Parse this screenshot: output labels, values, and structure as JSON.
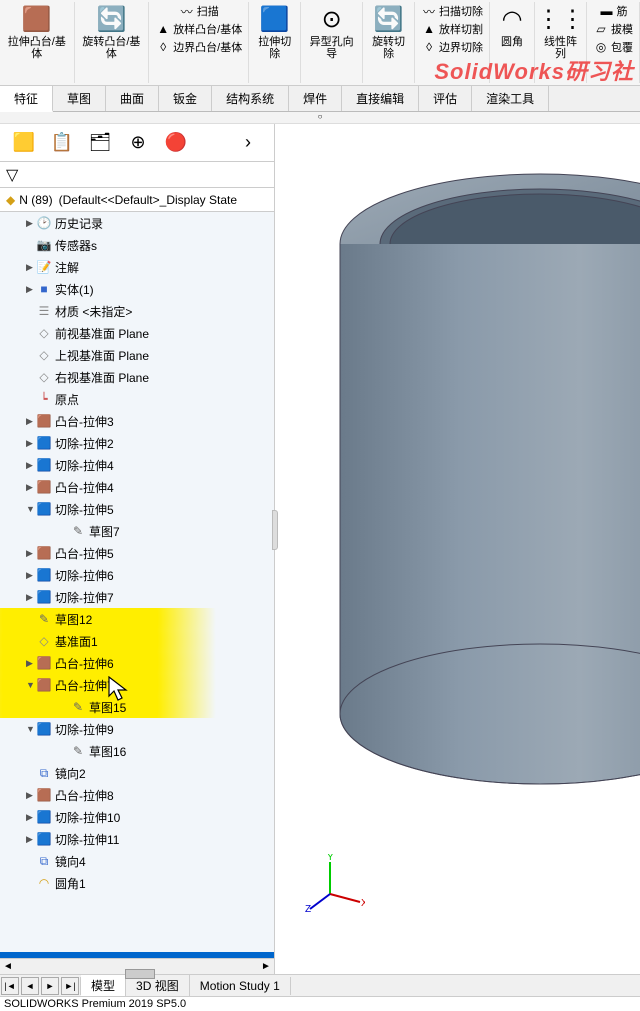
{
  "ribbon": {
    "extrudeBoss": "拉伸凸台/基体",
    "revolveBoss": "旋转凸台/基体",
    "sweep": "扫描",
    "loft": "放样凸台/基体",
    "boundary": "边界凸台/基体",
    "extrudeCut": "拉伸切除",
    "holeWizard": "异型孔向导",
    "revolveCut": "旋转切除",
    "sweptCut": "扫描切除",
    "loftCut": "放样切割",
    "boundaryCut": "边界切除",
    "fillet": "圆角",
    "linearPattern": "线性阵列",
    "rib": "筋",
    "draft": "拔模",
    "wrap": "包覆"
  },
  "tabs": {
    "feature": "特征",
    "sketch": "草图",
    "surface": "曲面",
    "sheetmetal": "钣金",
    "structure": "结构系统",
    "weldment": "焊件",
    "directEdit": "直接编辑",
    "evaluate": "评估",
    "renderTools": "渲染工具"
  },
  "header": {
    "partName": "N (89)",
    "config": "(Default<<Default>_Display State"
  },
  "tree": [
    {
      "label": "历史记录",
      "icon": "history",
      "exp": "▶",
      "indent": 1
    },
    {
      "label": "传感器s",
      "icon": "sensor",
      "exp": "",
      "indent": 1
    },
    {
      "label": "注解",
      "icon": "annotation",
      "exp": "▶",
      "indent": 1
    },
    {
      "label": "实体(1)",
      "icon": "solid",
      "exp": "▶",
      "indent": 1
    },
    {
      "label": "材质 <未指定>",
      "icon": "material",
      "exp": "",
      "indent": 1
    },
    {
      "label": "前视基准面 Plane",
      "icon": "plane",
      "exp": "",
      "indent": 1
    },
    {
      "label": "上视基准面 Plane",
      "icon": "plane",
      "exp": "",
      "indent": 1
    },
    {
      "label": "右视基准面 Plane",
      "icon": "plane",
      "exp": "",
      "indent": 1
    },
    {
      "label": "原点",
      "icon": "origin",
      "exp": "",
      "indent": 1
    },
    {
      "label": "凸台-拉伸3",
      "icon": "extrude",
      "exp": "▶",
      "indent": 1
    },
    {
      "label": "切除-拉伸2",
      "icon": "cut",
      "exp": "▶",
      "indent": 1
    },
    {
      "label": "切除-拉伸4",
      "icon": "cut",
      "exp": "▶",
      "indent": 1
    },
    {
      "label": "凸台-拉伸4",
      "icon": "extrude",
      "exp": "▶",
      "indent": 1
    },
    {
      "label": "切除-拉伸5",
      "icon": "cut",
      "exp": "▼",
      "indent": 1
    },
    {
      "label": "草图7",
      "icon": "sketch",
      "exp": "",
      "indent": 3
    },
    {
      "label": "凸台-拉伸5",
      "icon": "extrude",
      "exp": "▶",
      "indent": 1
    },
    {
      "label": "切除-拉伸6",
      "icon": "cut",
      "exp": "▶",
      "indent": 1
    },
    {
      "label": "切除-拉伸7",
      "icon": "cut",
      "exp": "▶",
      "indent": 1
    },
    {
      "label": "草图12",
      "icon": "sketch",
      "exp": "",
      "indent": 1,
      "hl": true
    },
    {
      "label": "基准面1",
      "icon": "plane",
      "exp": "",
      "indent": 1,
      "hl": true
    },
    {
      "label": "凸台-拉伸6",
      "icon": "extrude",
      "exp": "▶",
      "indent": 1,
      "hl": true
    },
    {
      "label": "凸台-拉伸7",
      "icon": "extrude",
      "exp": "▼",
      "indent": 1,
      "hl": true
    },
    {
      "label": "草图15",
      "icon": "sketch",
      "exp": "",
      "indent": 3,
      "hl": true
    },
    {
      "label": "切除-拉伸9",
      "icon": "cut",
      "exp": "▼",
      "indent": 1
    },
    {
      "label": "草图16",
      "icon": "sketch",
      "exp": "",
      "indent": 3
    },
    {
      "label": "镜向2",
      "icon": "mirror",
      "exp": "",
      "indent": 1
    },
    {
      "label": "凸台-拉伸8",
      "icon": "extrude",
      "exp": "▶",
      "indent": 1
    },
    {
      "label": "切除-拉伸10",
      "icon": "cut",
      "exp": "▶",
      "indent": 1
    },
    {
      "label": "切除-拉伸11",
      "icon": "cut",
      "exp": "▶",
      "indent": 1
    },
    {
      "label": "镜向4",
      "icon": "mirror",
      "exp": "",
      "indent": 1
    },
    {
      "label": "圆角1",
      "icon": "fillet",
      "exp": "",
      "indent": 1
    }
  ],
  "bottomTabs": {
    "model": "模型",
    "view3d": "3D 视图",
    "motion": "Motion Study 1"
  },
  "status": "SOLIDWORKS Premium 2019 SP5.0",
  "watermark": "SolidWorks研习社",
  "icons": {
    "extrude": "🟫",
    "cut": "🟦",
    "sketch": "✎",
    "plane": "◇",
    "origin": "┕",
    "history": "🕑",
    "sensor": "📷",
    "annotation": "📝",
    "solid": "■",
    "material": "☰",
    "mirror": "⧉",
    "fillet": "◠"
  }
}
